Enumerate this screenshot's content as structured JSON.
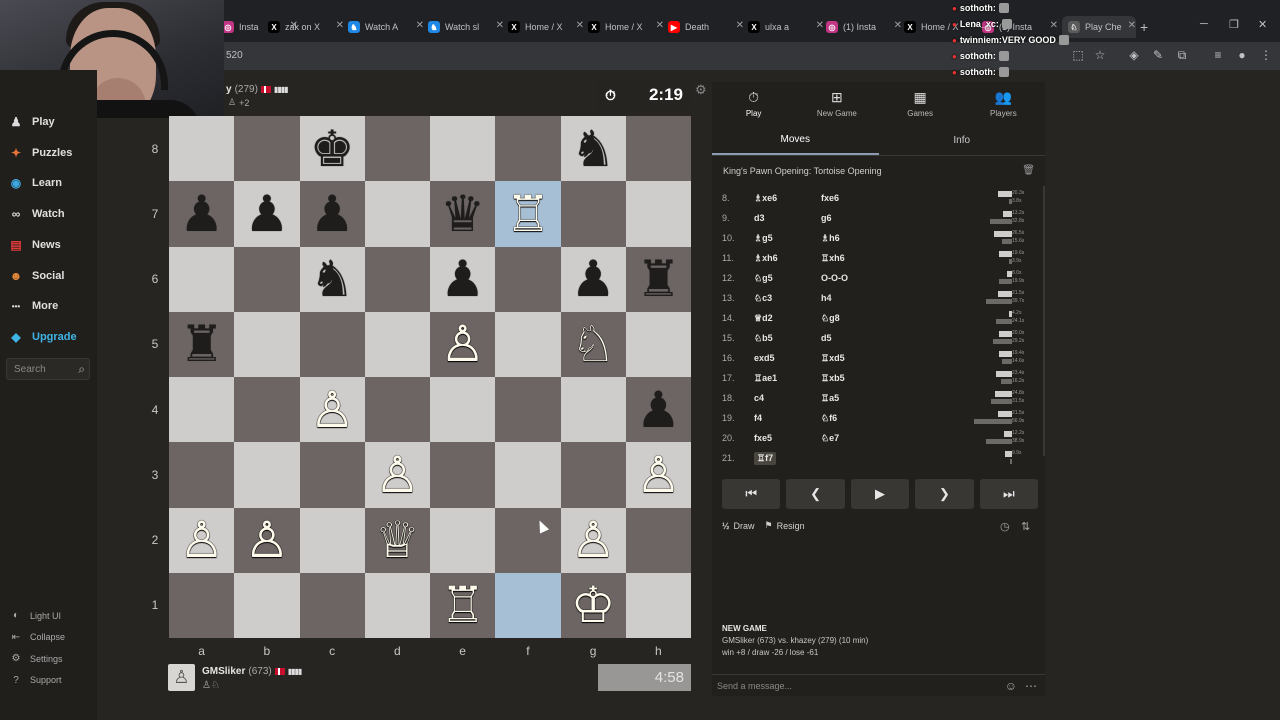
{
  "browser": {
    "tabs": [
      {
        "label": "Insta",
        "icon": "instagram-icon",
        "color": "#c13584"
      },
      {
        "label": "zak on X",
        "icon": "x-icon",
        "color": "#000000"
      },
      {
        "label": "Watch A",
        "icon": "chesscom-icon",
        "color": "#1e88e5"
      },
      {
        "label": "Watch sl",
        "icon": "chesscom-icon",
        "color": "#1e88e5"
      },
      {
        "label": "Home / X",
        "icon": "x-icon",
        "color": "#000000"
      },
      {
        "label": "Home / X",
        "icon": "x-icon",
        "color": "#000000"
      },
      {
        "label": "Death",
        "icon": "youtube-icon",
        "color": "#ff0000"
      },
      {
        "label": "ulxa a",
        "icon": "x-icon",
        "color": "#000000"
      },
      {
        "label": "(1) Insta",
        "icon": "instagram-icon",
        "color": "#c13584"
      },
      {
        "label": "Home / X",
        "icon": "x-icon",
        "color": "#000000"
      },
      {
        "label": "(1) Insta",
        "icon": "instagram-icon",
        "color": "#c13584"
      },
      {
        "label": "Play Che",
        "icon": "lichess-icon",
        "color": "#5a5a5a"
      }
    ],
    "address": "520"
  },
  "chat_overlay": [
    {
      "user": "sothoth",
      "text": ""
    },
    {
      "user": "Lena_xc",
      "text": ""
    },
    {
      "user": "twinniem",
      "text": "VERY GOOD"
    },
    {
      "user": "sothoth",
      "text": ""
    },
    {
      "user": "sothoth",
      "text": ""
    },
    {
      "user": "sothoth",
      "text": ""
    },
    {
      "user": "sothoth",
      "text": ""
    },
    {
      "user": "sothoth",
      "text": ""
    }
  ],
  "sidebar": {
    "items": [
      {
        "label": "Play",
        "icon": "pawn-icon"
      },
      {
        "label": "Puzzles",
        "icon": "puzzle-icon"
      },
      {
        "label": "Learn",
        "icon": "learn-icon"
      },
      {
        "label": "Watch",
        "icon": "binoculars-icon"
      },
      {
        "label": "News",
        "icon": "news-icon"
      },
      {
        "label": "Social",
        "icon": "social-icon"
      },
      {
        "label": "More",
        "icon": "more-icon"
      },
      {
        "label": "Upgrade",
        "icon": "diamond-icon"
      }
    ],
    "search_placeholder": "Search",
    "bottom": [
      {
        "label": "Light UI",
        "icon": "light-ui-icon"
      },
      {
        "label": "Collapse",
        "icon": "collapse-icon"
      },
      {
        "label": "Settings",
        "icon": "gear-icon"
      },
      {
        "label": "Support",
        "icon": "support-icon"
      }
    ]
  },
  "top_player": {
    "name": "y",
    "rating": "(279)",
    "captures": "+2"
  },
  "bottom_player": {
    "name": "GMSliker",
    "rating": "(673)"
  },
  "clocks": {
    "top": "2:19",
    "bottom": "4:58"
  },
  "board": {
    "ranks": [
      "8",
      "7",
      "6",
      "5",
      "4",
      "3",
      "2",
      "1"
    ],
    "files": [
      "a",
      "b",
      "c",
      "d",
      "e",
      "f",
      "g",
      "h"
    ],
    "highlighted": [
      "f7",
      "f1"
    ],
    "pieces": [
      {
        "sq": "c8",
        "p": "♚",
        "c": "b"
      },
      {
        "sq": "g8",
        "p": "♞",
        "c": "b"
      },
      {
        "sq": "a7",
        "p": "♟",
        "c": "b"
      },
      {
        "sq": "b7",
        "p": "♟",
        "c": "b"
      },
      {
        "sq": "c7",
        "p": "♟",
        "c": "b"
      },
      {
        "sq": "e7",
        "p": "♛",
        "c": "b"
      },
      {
        "sq": "f7",
        "p": "♖",
        "c": "w"
      },
      {
        "sq": "c6",
        "p": "♞",
        "c": "b"
      },
      {
        "sq": "e6",
        "p": "♟",
        "c": "b"
      },
      {
        "sq": "g6",
        "p": "♟",
        "c": "b"
      },
      {
        "sq": "h6",
        "p": "♜",
        "c": "b"
      },
      {
        "sq": "a5",
        "p": "♜",
        "c": "b"
      },
      {
        "sq": "e5",
        "p": "♙",
        "c": "w"
      },
      {
        "sq": "g5",
        "p": "♘",
        "c": "w"
      },
      {
        "sq": "c4",
        "p": "♙",
        "c": "w"
      },
      {
        "sq": "h4",
        "p": "♟",
        "c": "b"
      },
      {
        "sq": "d3",
        "p": "♙",
        "c": "w"
      },
      {
        "sq": "h3",
        "p": "♙",
        "c": "w"
      },
      {
        "sq": "a2",
        "p": "♙",
        "c": "w"
      },
      {
        "sq": "b2",
        "p": "♙",
        "c": "w"
      },
      {
        "sq": "d2",
        "p": "♕",
        "c": "w"
      },
      {
        "sq": "g2",
        "p": "♙",
        "c": "w"
      },
      {
        "sq": "e1",
        "p": "♖",
        "c": "w"
      },
      {
        "sq": "g1",
        "p": "♔",
        "c": "w"
      }
    ]
  },
  "panel": {
    "tabs": [
      {
        "label": "Play",
        "icon": "clock-icon"
      },
      {
        "label": "New Game",
        "icon": "plus-icon"
      },
      {
        "label": "Games",
        "icon": "games-icon"
      },
      {
        "label": "Players",
        "icon": "players-icon"
      }
    ],
    "subtabs": [
      "Moves",
      "Info"
    ],
    "opening": "King's Pawn Opening: Tortoise Opening",
    "moves": [
      {
        "n": "8.",
        "w": "♗xe6",
        "b": "fxe6"
      },
      {
        "n": "9.",
        "w": "d3",
        "b": "g6"
      },
      {
        "n": "10.",
        "w": "♗g5",
        "b": "♗h6"
      },
      {
        "n": "11.",
        "w": "♗xh6",
        "b": "♖xh6"
      },
      {
        "n": "12.",
        "w": "♘g5",
        "b": "O-O-O"
      },
      {
        "n": "13.",
        "w": "♘c3",
        "b": "h4"
      },
      {
        "n": "14.",
        "w": "♕d2",
        "b": "♘g8"
      },
      {
        "n": "15.",
        "w": "♘b5",
        "b": "d5"
      },
      {
        "n": "16.",
        "w": "exd5",
        "b": "♖xd5"
      },
      {
        "n": "17.",
        "w": "♖ae1",
        "b": "♖xb5"
      },
      {
        "n": "18.",
        "w": "c4",
        "b": "♖a5"
      },
      {
        "n": "19.",
        "w": "f4",
        "b": "♘f6"
      },
      {
        "n": "20.",
        "w": "fxe5",
        "b": "♘e7"
      },
      {
        "n": "21.",
        "w": "♖f7",
        "b": ""
      }
    ],
    "times": [
      {
        "w": "20.3s",
        "b": "3.8s"
      },
      {
        "w": "13.2s",
        "b": "32.8s"
      },
      {
        "w": "26.5s",
        "b": "15.6s"
      },
      {
        "w": "19.6s",
        "b": "3.9s"
      },
      {
        "w": "8.0s",
        "b": "19.9s"
      },
      {
        "w": "21.5s",
        "b": "39.7s"
      },
      {
        "w": "4.2s",
        "b": "24.1s"
      },
      {
        "w": "20.0s",
        "b": "29.2s"
      },
      {
        "w": "19.4s",
        "b": "14.6s"
      },
      {
        "w": "23.4s",
        "b": "16.2s"
      },
      {
        "w": "24.8s",
        "b": "31.5s"
      },
      {
        "w": "21.5s",
        "b": "56.9s"
      },
      {
        "w": "12.2s",
        "b": "38.9s"
      },
      {
        "w": "9.9s",
        "b": ""
      }
    ],
    "draw_label": "Draw",
    "resign_label": "Resign",
    "new_game": {
      "title": "NEW GAME",
      "line1": "GMSliker (673) vs. khazey (279) (10 min)",
      "line2": "win +8 / draw -26 / lose -61"
    },
    "message_placeholder": "Send a message..."
  }
}
